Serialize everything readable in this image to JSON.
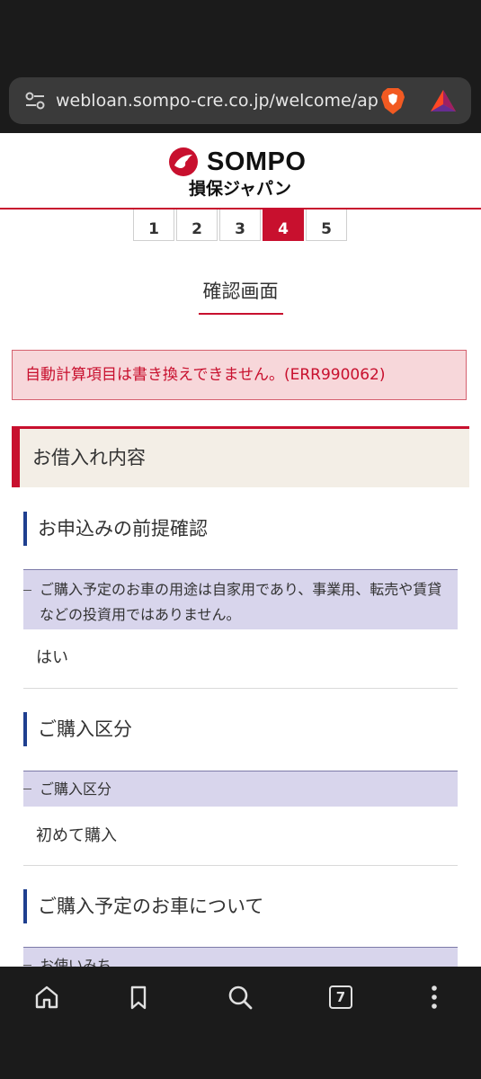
{
  "browser": {
    "url": "webloan.sompo-cre.co.jp/welcome/ap",
    "tab_count": "7"
  },
  "header": {
    "brand": "SOMPO",
    "brand_sub": "損保ジャパン",
    "accent_color": "#c8102e"
  },
  "steps": {
    "items": [
      "1",
      "2",
      "3",
      "4",
      "5"
    ],
    "active": "4"
  },
  "page_title": "確認画面",
  "error": {
    "message": "自動計算項目は書き換えできません。(ERR990062)"
  },
  "section": {
    "title": "お借入れ内容"
  },
  "subsections": [
    {
      "title": "お申込みの前提確認",
      "question": "ご購入予定のお車の用途は自家用であり、事業用、転売や賃貸などの投資用ではありません。",
      "answer": "はい"
    },
    {
      "title": "ご購入区分",
      "question": "ご購入区分",
      "answer": "初めて購入"
    },
    {
      "title": "ご購入予定のお車について",
      "question": "お使いみち"
    }
  ],
  "navbar": {
    "items": [
      "home-icon",
      "bookmark-icon",
      "search-icon",
      "tabs-icon",
      "more-icon"
    ]
  }
}
